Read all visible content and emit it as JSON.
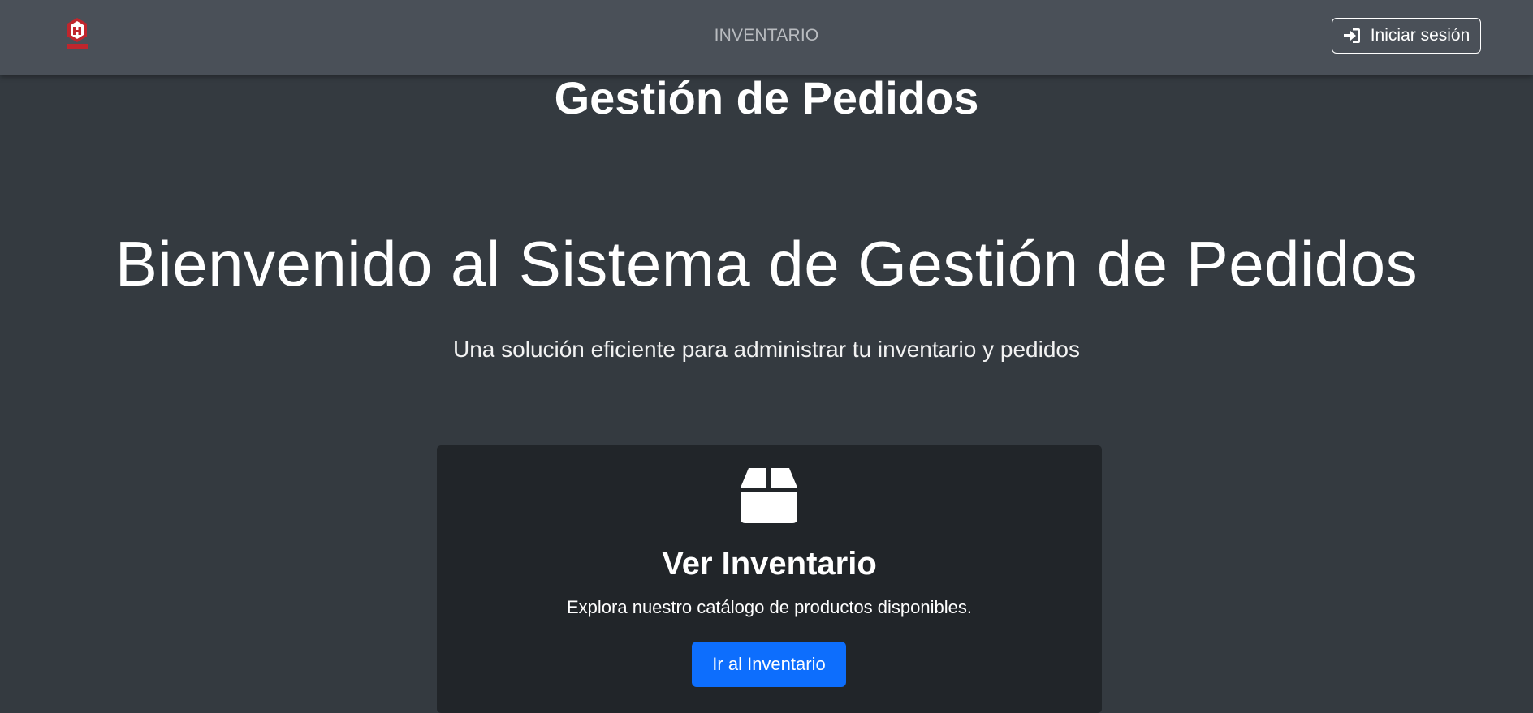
{
  "navbar": {
    "logo_icon": "house-brand-logo",
    "logo_caption": "LIKE HOME",
    "link_label": "INVENTARIO",
    "login_label": "Iniciar sesión",
    "login_icon": "sign-in-icon"
  },
  "page": {
    "title": "Gestión de Pedidos"
  },
  "hero": {
    "title": "Bienvenido al Sistema de Gestión de Pedidos",
    "subtitle": "Una solución eficiente para administrar tu inventario y pedidos"
  },
  "card": {
    "icon": "box-icon",
    "title": "Ver Inventario",
    "text": "Explora nuestro catálogo de productos disponibles.",
    "button_label": "Ir al Inventario"
  },
  "colors": {
    "background": "#343a40",
    "navbar": "#4a5058",
    "card": "#212529",
    "primary": "#0d6efd",
    "logo_red": "#c0262d"
  }
}
